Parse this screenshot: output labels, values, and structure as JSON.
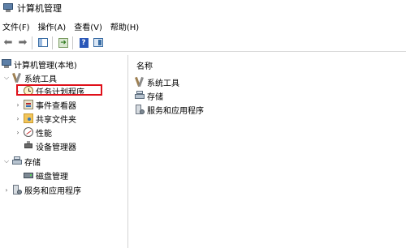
{
  "window": {
    "title": "计算机管理"
  },
  "menu": [
    "文件(F)",
    "操作(A)",
    "查看(V)",
    "帮助(H)"
  ],
  "toolbar": {
    "back_icon": "arrow-left-icon",
    "forward_icon": "arrow-right-icon",
    "show_hide_tree_icon": "console-tree-icon",
    "export_icon": "export-list-icon",
    "help_icon": "help-icon",
    "action_pane_icon": "action-pane-icon"
  },
  "tree": {
    "root": "计算机管理(本地)",
    "system_tools": "系统工具",
    "task_scheduler": "任务计划程序",
    "event_viewer": "事件查看器",
    "shared_folders": "共享文件夹",
    "performance": "性能",
    "device_manager": "设备管理器",
    "storage": "存储",
    "disk_management": "磁盘管理",
    "services_apps": "服务和应用程序"
  },
  "content": {
    "column_name": "名称",
    "items": [
      "系统工具",
      "存储",
      "服务和应用程序"
    ]
  },
  "highlight": {
    "color": "#e0101a",
    "target": "任务计划程序"
  }
}
